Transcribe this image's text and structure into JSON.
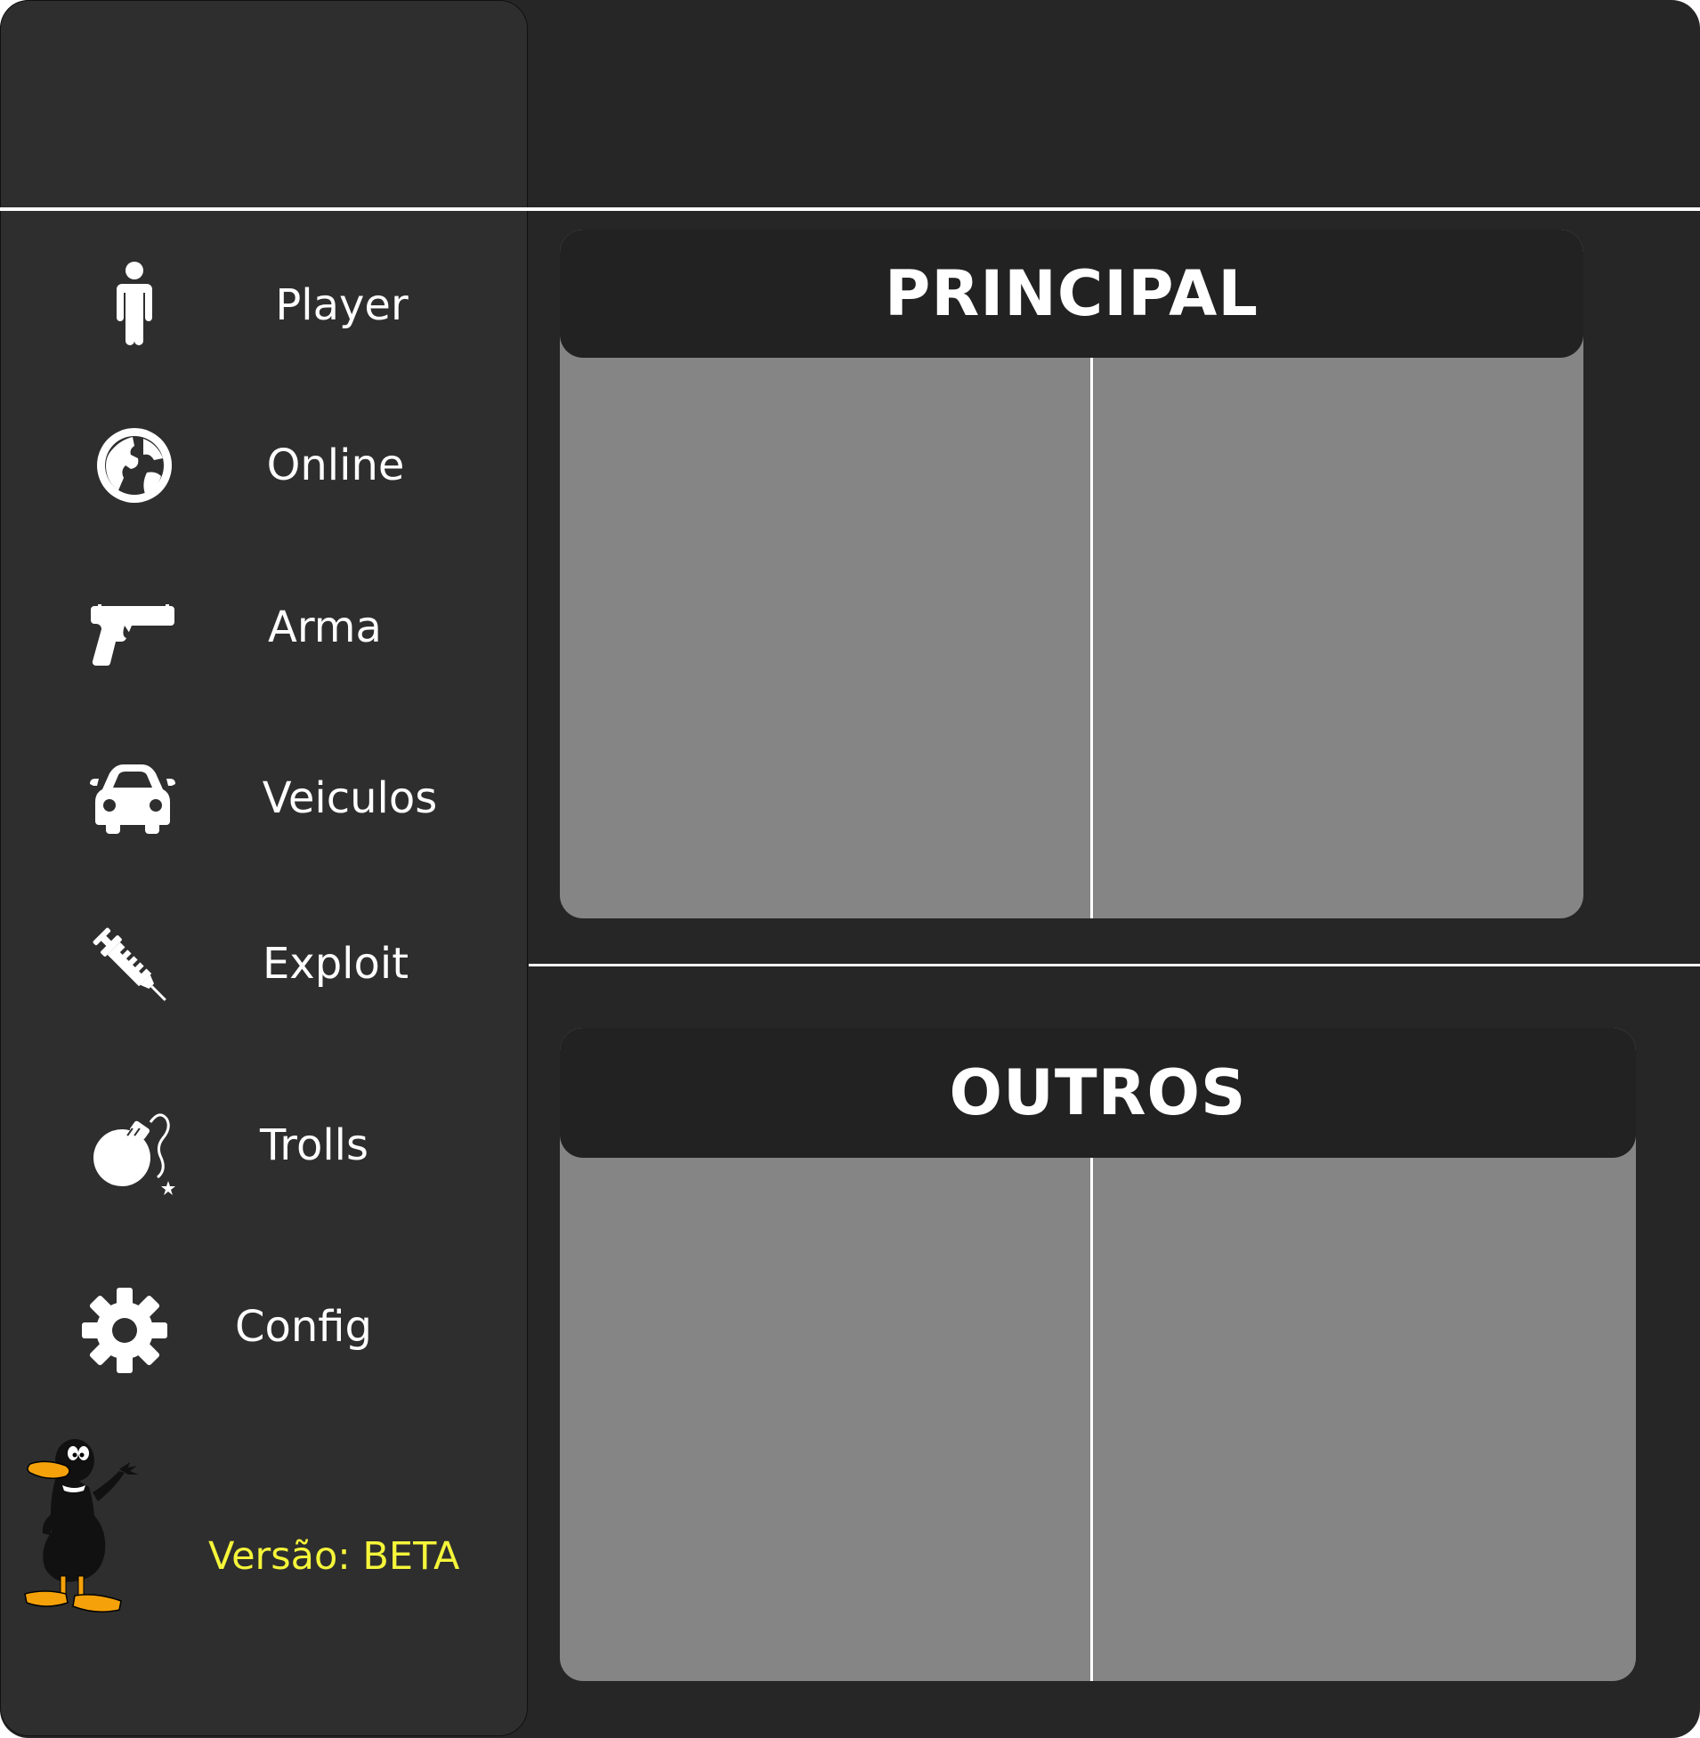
{
  "sidebar": {
    "items": [
      {
        "label": "Player",
        "icon": "person-icon"
      },
      {
        "label": "Online",
        "icon": "globe-icon"
      },
      {
        "label": "Arma",
        "icon": "pistol-icon"
      },
      {
        "label": "Veiculos",
        "icon": "car-icon"
      },
      {
        "label": "Exploit",
        "icon": "syringe-icon"
      },
      {
        "label": "Trolls",
        "icon": "bomb-icon"
      },
      {
        "label": "Config",
        "icon": "gear-icon"
      }
    ],
    "version": "Versão: BETA",
    "mascot_icon": "duck-mascot-icon"
  },
  "sections": {
    "principal": {
      "title": "PRINCIPAL"
    },
    "outros": {
      "title": "OUTROS"
    }
  },
  "colors": {
    "window_background": "#262626",
    "sidebar_background": "#2e2e2e",
    "panel_body": "#858585",
    "panel_header": "#222222",
    "text": "#ffffff",
    "version_text": "#f5f53a"
  }
}
